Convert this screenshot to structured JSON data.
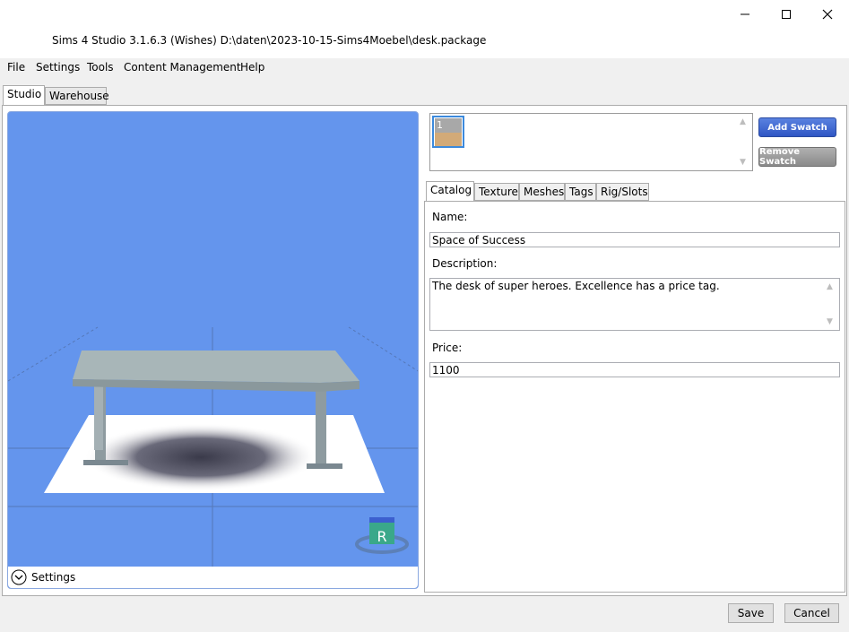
{
  "window": {
    "title": "Sims 4 Studio 3.1.6.3 (Wishes)  D:\\daten\\2023-10-15-Sims4Moebel\\desk.package",
    "minimize_glyph": "–",
    "maximize_glyph": "☐",
    "close_glyph": "✕"
  },
  "menu": [
    "File",
    "Settings",
    "Tools",
    "Content Management",
    "Help"
  ],
  "main_tabs": [
    {
      "label": "Studio",
      "active": true
    },
    {
      "label": "Warehouse",
      "active": false
    }
  ],
  "viewport": {
    "background": "#6495ed",
    "rotate_gizmo_letter": "R",
    "settings_label": "Settings",
    "settings_icon": "chevron-circle-down-icon"
  },
  "swatches": {
    "items": [
      {
        "number": "1",
        "top_color": "#b0b0b0",
        "bottom_color": "#d2aa78"
      }
    ],
    "add_label": "Add Swatch",
    "remove_label": "Remove Swatch"
  },
  "inner_tabs": [
    {
      "label": "Catalog",
      "active": true
    },
    {
      "label": "Texture",
      "active": false
    },
    {
      "label": "Meshes",
      "active": false
    },
    {
      "label": "Tags",
      "active": false
    },
    {
      "label": "Rig/Slots",
      "active": false
    }
  ],
  "catalog": {
    "name_label": "Name:",
    "name_value": "Space of Success",
    "description_label": "Description:",
    "description_value": "The desk of super heroes. Excellence has a price tag.",
    "price_label": "Price:",
    "price_value": "1100"
  },
  "footer": {
    "save_label": "Save",
    "cancel_label": "Cancel"
  }
}
